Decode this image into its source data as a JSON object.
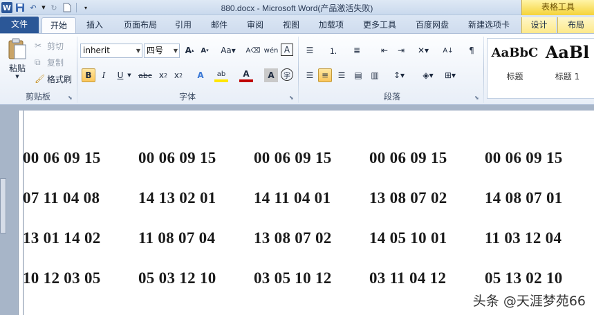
{
  "titlebar": {
    "title": "880.docx - Microsoft Word(产品激活失败)",
    "context_tab_group": "表格工具"
  },
  "tabs": [
    {
      "label": "文件"
    },
    {
      "label": "开始"
    },
    {
      "label": "插入"
    },
    {
      "label": "页面布局"
    },
    {
      "label": "引用"
    },
    {
      "label": "邮件"
    },
    {
      "label": "审阅"
    },
    {
      "label": "视图"
    },
    {
      "label": "加载项"
    },
    {
      "label": "更多工具"
    },
    {
      "label": "百度网盘"
    },
    {
      "label": "新建选项卡"
    },
    {
      "label": "设计"
    },
    {
      "label": "布局"
    }
  ],
  "clipboard": {
    "paste": "粘贴",
    "cut": "剪切",
    "copy": "复制",
    "format_painter": "格式刷",
    "group": "剪贴板"
  },
  "font": {
    "name": "inherit",
    "size": "四号",
    "group": "字体"
  },
  "paragraph": {
    "group": "段落"
  },
  "styles": [
    {
      "sample": "AaBbC",
      "name": "标题"
    },
    {
      "sample": "AaBl",
      "name": "标题 1"
    }
  ],
  "document": {
    "rows": [
      [
        "00 06 09 15",
        "00 06 09 15",
        "00 06 09 15",
        "00 06 09 15",
        "00 06 09 15"
      ],
      [
        "07 11 04 08",
        "14 13 02 01",
        "14 11 04 01",
        "13 08 07 02",
        "14 08 07 01"
      ],
      [
        "13 01 14 02",
        "11 08 07 04",
        "13 08 07 02",
        "14 05 10 01",
        "11 03 12 04"
      ],
      [
        "10 12 03 05",
        "05 03 12 10",
        "03 05 10 12",
        "03 11 04 12",
        "05 13 02 10"
      ]
    ]
  },
  "watermark": "头条 @天涯梦苑66",
  "colors": {
    "file_tab": "#2b5797",
    "context_tab": "#f5d33a",
    "highlight": "#ffe600",
    "font_color": "#c00000"
  }
}
